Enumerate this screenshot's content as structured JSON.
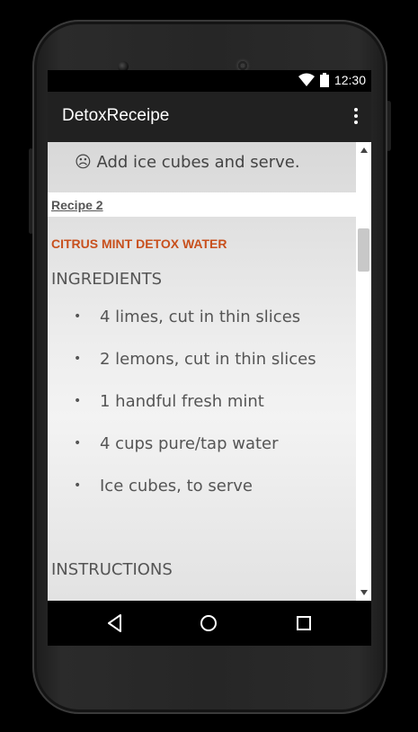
{
  "status_bar": {
    "time": "12:30",
    "icons": [
      "wifi-icon",
      "battery-icon"
    ]
  },
  "app_bar": {
    "title": "DetoxReceipe",
    "menu_icon": "overflow-menu-icon"
  },
  "content": {
    "previous_step": "☹ Add ice cubes and serve.",
    "recipe_link": "Recipe 2",
    "recipe_title": "CITRUS MINT DETOX WATER",
    "ingredients_heading": "INGREDIENTS",
    "ingredients": [
      "4 limes, cut in thin slices",
      "2 lemons, cut in thin slices",
      "1 handful fresh mint",
      "4 cups pure/tap water",
      "Ice cubes, to serve"
    ],
    "bullet": "•",
    "instructions_heading": "INSTRUCTIONS"
  },
  "nav_bar": {
    "buttons": [
      "back-icon",
      "home-icon",
      "recents-icon"
    ]
  },
  "colors": {
    "app_bar": "#212121",
    "recipe_title": "#c8501d",
    "text": "#555555"
  }
}
